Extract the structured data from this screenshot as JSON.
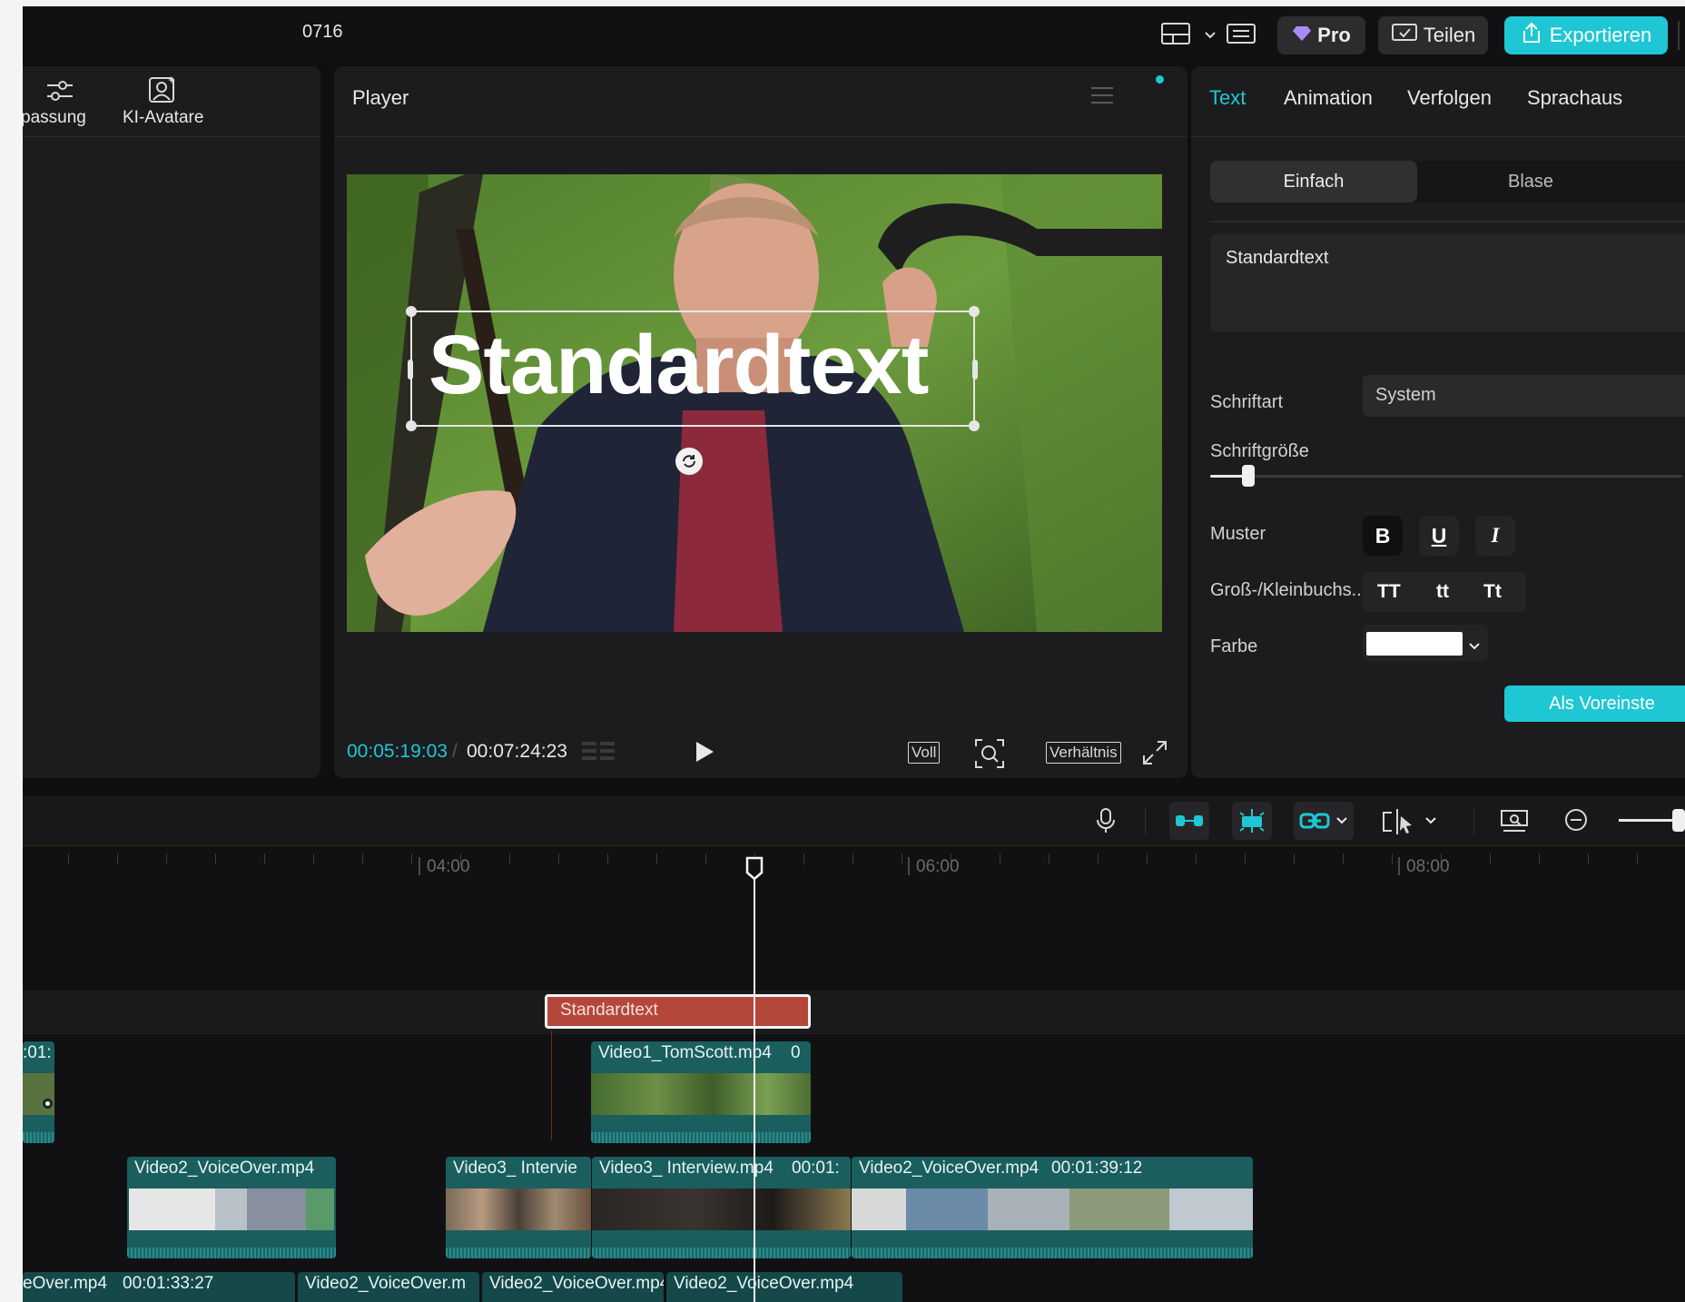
{
  "header": {
    "project_name": "0716",
    "pro_label": "Pro",
    "share_label": "Teilen",
    "export_label": "Exportieren"
  },
  "left_panel": {
    "tab_adjust": "passung",
    "tab_avatar": "KI-Avatare"
  },
  "player": {
    "title": "Player",
    "overlay_text": "Standardtext",
    "time_current": "00:05:19:03",
    "time_total": "00:07:24:23",
    "btn_full": "Voll",
    "btn_ratio": "Verhältnis"
  },
  "right_panel": {
    "tabs": [
      "Text",
      "Animation",
      "Verfolgen",
      "Sprachaus"
    ],
    "subtab_simple": "Einfach",
    "subtab_bubble": "Blase",
    "text_value": "Standardtext",
    "font_label": "Schriftart",
    "font_value": "System",
    "size_label": "Schriftgröße",
    "size_level": 0.08,
    "style_label": "Muster",
    "style_bold": "B",
    "style_underline": "U",
    "style_italic": "I",
    "case_label": "Groß-/Kleinbuchs...",
    "case_upper": "TT",
    "case_lower": "tt",
    "case_title": "Tt",
    "color_label": "Farbe",
    "color_value": "#ffffff",
    "preset_button": "Als Voreinste"
  },
  "timeline": {
    "ruler": [
      "04:00",
      "06:00",
      "08:00"
    ],
    "text_clip": "Standardtext",
    "track1": [
      {
        "label": ":01:"
      },
      {
        "label": "Video1_TomScott.mp4",
        "time": "0"
      }
    ],
    "track2": [
      {
        "label": "Video2_VoiceOver.mp4",
        "time": ""
      },
      {
        "label": "Video3_ Intervie",
        "time": ""
      },
      {
        "label": "Video3_ Interview.mp4",
        "time": "00:01:"
      },
      {
        "label": "Video2_VoiceOver.mp4",
        "time": "00:01:39:12"
      }
    ],
    "track3": [
      {
        "label": "eOver.mp4",
        "time": "00:01:33:27"
      },
      {
        "label": "Video2_VoiceOver.m",
        "time": ""
      },
      {
        "label": "Video2_VoiceOver.mp4",
        "time": ""
      },
      {
        "label": "Video2_VoiceOver.mp4",
        "time": ""
      }
    ],
    "zoom_level": 0.9
  },
  "colors": {
    "accent": "#1fc7d4",
    "text_clip": "#b4473a",
    "video_clip": "#1a5e5e"
  }
}
